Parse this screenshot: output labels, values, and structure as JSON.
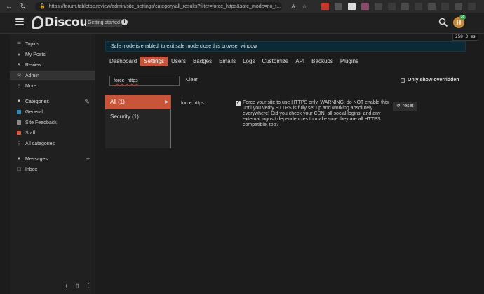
{
  "browser": {
    "url": "https://forum.tabletpc.review/admin/site_settings/category/all_results?filter=force_https&safe_mode=no_t..."
  },
  "header": {
    "logo_text": "Discourse",
    "getting_started": "Getting started",
    "info_symbol": "i",
    "avatar_letter": "H",
    "avatar_badge": "38",
    "timing": "258.3 ms"
  },
  "sidebar": {
    "items": [
      {
        "label": "Topics",
        "icon": "layers-icon"
      },
      {
        "label": "My Posts",
        "icon": "user-icon"
      },
      {
        "label": "Review",
        "icon": "flag-icon"
      },
      {
        "label": "Admin",
        "icon": "wrench-icon"
      },
      {
        "label": "More",
        "icon": "ellipsis-icon"
      }
    ],
    "categories_heading": "Categories",
    "categories": [
      {
        "label": "General",
        "color": "#2a8fc0"
      },
      {
        "label": "Site Feedback",
        "color": "#8a8a8a"
      },
      {
        "label": "Staff",
        "color": "#e45735"
      },
      {
        "label": "All categories",
        "color": ""
      }
    ],
    "messages_heading": "Messages",
    "messages": [
      {
        "label": "Inbox"
      }
    ]
  },
  "main": {
    "safe_mode_banner": "Safe mode is enabled, to exit safe mode close this browser window",
    "tabs": [
      "Dashboard",
      "Settings",
      "Users",
      "Badges",
      "Emails",
      "Logs",
      "Customize",
      "API",
      "Backups",
      "Plugins"
    ],
    "active_tab": "Settings",
    "filter_value": "force_https",
    "clear_label": "Clear",
    "only_overridden_label": "Only show overridden",
    "setting_categories": [
      {
        "label": "All (1)",
        "active": true
      },
      {
        "label": "Security (1)",
        "active": false
      }
    ],
    "setting": {
      "name": "force https",
      "checked": true,
      "description": "Force your site to use HTTPS only. WARNING: do NOT enable this until you verify HTTPS is fully set up and working absolutely everywhere! Did you check your CDN, all social logins, and any external logos / dependencies to make sure they are all HTTPS compatible, too?",
      "reset_label": "reset"
    }
  },
  "colors": {
    "accent": "#c8553a",
    "banner_bg": "#0b2a36",
    "background": "#1c1c1c"
  }
}
